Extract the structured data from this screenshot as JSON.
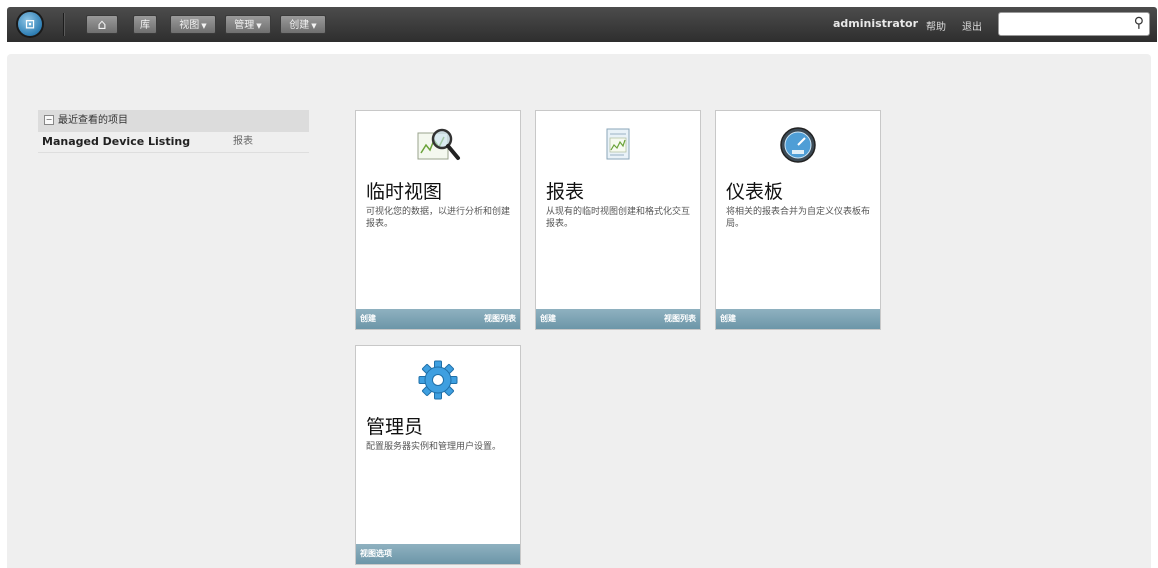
{
  "topbar": {
    "home_glyph": "⌂",
    "library_label": "库",
    "view_label": "视图",
    "manage_label": "管理",
    "create_label": "创建",
    "username": "administrator",
    "help_label": "帮助",
    "logout_label": "退出",
    "search_placeholder": "",
    "search_glyph": "⚲"
  },
  "recent": {
    "header": "最近查看的项目",
    "items": [
      {
        "name": "Managed Device Listing",
        "type": "报表"
      }
    ]
  },
  "cards": [
    {
      "title": "临时视图",
      "desc": "可视化您的数据，以进行分析和创建报表。",
      "footer_left": "创建",
      "footer_right": "视图列表",
      "icon": "chart-magnifier-icon"
    },
    {
      "title": "报表",
      "desc": "从现有的临时视图创建和格式化交互报表。",
      "footer_left": "创建",
      "footer_right": "视图列表",
      "icon": "report-icon"
    },
    {
      "title": "仪表板",
      "desc": "将相关的报表合并为自定义仪表板布局。",
      "footer_left": "创建",
      "footer_right": "",
      "icon": "dashboard-gauge-icon"
    },
    {
      "title": "管理员",
      "desc": "配置服务器实例和管理用户设置。",
      "footer_left": "视图选项",
      "footer_right": "",
      "icon": "gear-icon"
    }
  ],
  "colors": {
    "topbar": "#3a3a3a",
    "footer": "#7aa1b2",
    "frame": "#efefef"
  }
}
